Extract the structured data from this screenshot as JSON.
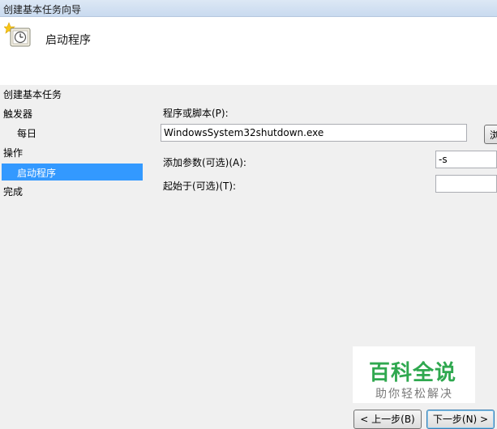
{
  "window": {
    "title": "创建基本任务向导"
  },
  "header": {
    "title": "启动程序",
    "icon": "task-clock-icon"
  },
  "sidebar": {
    "items": [
      {
        "label": "创建基本任务"
      },
      {
        "label": "触发器"
      },
      {
        "label": "每日"
      },
      {
        "label": "操作"
      },
      {
        "label": "启动程序",
        "selected": true
      },
      {
        "label": "完成"
      }
    ],
    "selected_color": "#3399ff"
  },
  "form": {
    "program_label": "程序或脚本(P):",
    "program_value": "WindowsSystem32shutdown.exe",
    "browse_label": "浏",
    "args_label": "添加参数(可选)(A):",
    "args_value": "-s",
    "start_in_label": "起始于(可选)(T):",
    "start_in_value": ""
  },
  "buttons": {
    "back": "< 上一步(B)",
    "next": "下一步(N) >"
  },
  "watermark": {
    "title": "百科全说",
    "subtitle": "助你轻松解决",
    "color": "#2fa84f"
  }
}
